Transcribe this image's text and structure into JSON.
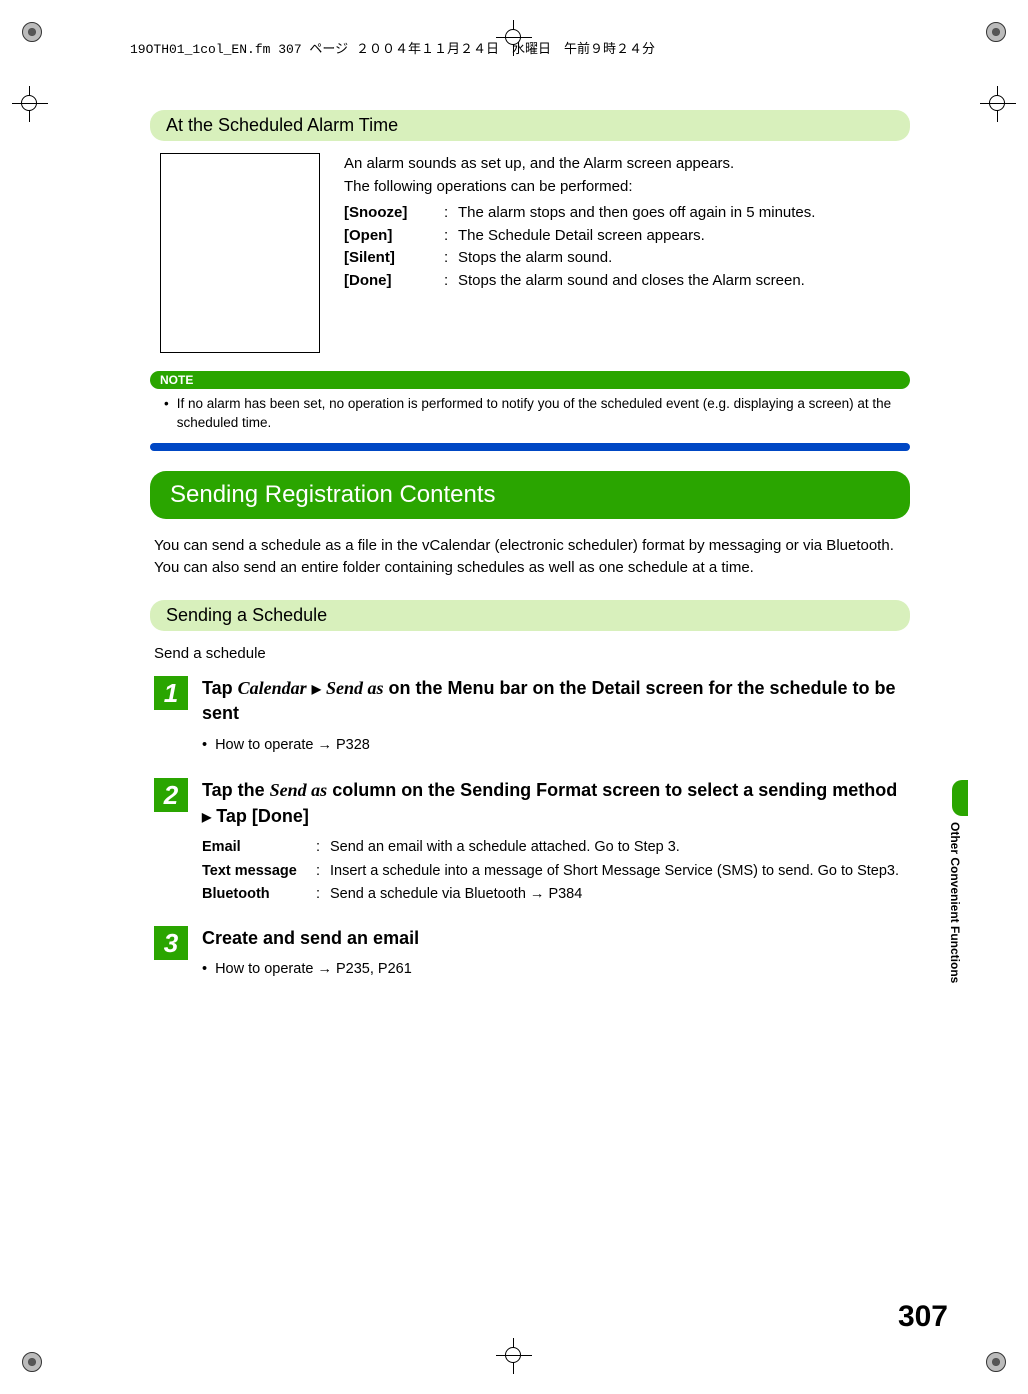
{
  "header_info": "19OTH01_1col_EN.fm  307 ページ  ２００４年１１月２４日　水曜日　午前９時２４分",
  "sub1_title": "At the Scheduled Alarm Time",
  "alarm_intro1": "An alarm sounds as set up, and the Alarm screen appears.",
  "alarm_intro2": "The following operations can be performed:",
  "defs": {
    "snooze_term": "[Snooze]",
    "snooze_desc": "The alarm stops and then goes off again in 5 minutes.",
    "open_term": "[Open]",
    "open_desc": "The Schedule Detail screen appears.",
    "silent_term": "[Silent]",
    "silent_desc": "Stops the alarm sound.",
    "done_term": "[Done]",
    "done_desc": "Stops the alarm sound and closes the Alarm screen."
  },
  "note_label": "NOTE",
  "note_text": "If no alarm has been set, no operation is performed to notify you of the scheduled event (e.g. displaying a screen) at the scheduled time.",
  "section_title": "Sending Registration Contents",
  "section_intro": "You can send a schedule as a file in the vCalendar (electronic scheduler) format by messaging or via Bluetooth. You can also send an entire folder containing schedules as well as one schedule at a time.",
  "sub2_title": "Sending a Schedule",
  "sub2_lead": "Send a schedule",
  "step1": {
    "num": "1",
    "prefix": "Tap ",
    "menu1": "Calendar",
    "menu2": "Send as",
    "suffix": " on the Menu bar on the Detail screen for the schedule to be sent",
    "bullet": "How to operate → P328"
  },
  "step2": {
    "num": "2",
    "prefix": "Tap the ",
    "menu": "Send as",
    "mid": " column on the Sending Format screen to select a sending method ",
    "suffix": " Tap [Done]",
    "methods": {
      "email_term": "Email",
      "email_desc": "Send an email with a schedule attached. Go to Step 3.",
      "text_term": "Text message",
      "text_desc": "Insert a schedule into a message of Short Message Service (SMS) to send. Go to Step3.",
      "bt_term": "Bluetooth",
      "bt_desc": "Send a schedule via Bluetooth → P384"
    }
  },
  "step3": {
    "num": "3",
    "title": "Create and send an email",
    "bullet": "How to operate → P235, P261"
  },
  "side_label": "Other Convenient Functions",
  "page_number": "307"
}
